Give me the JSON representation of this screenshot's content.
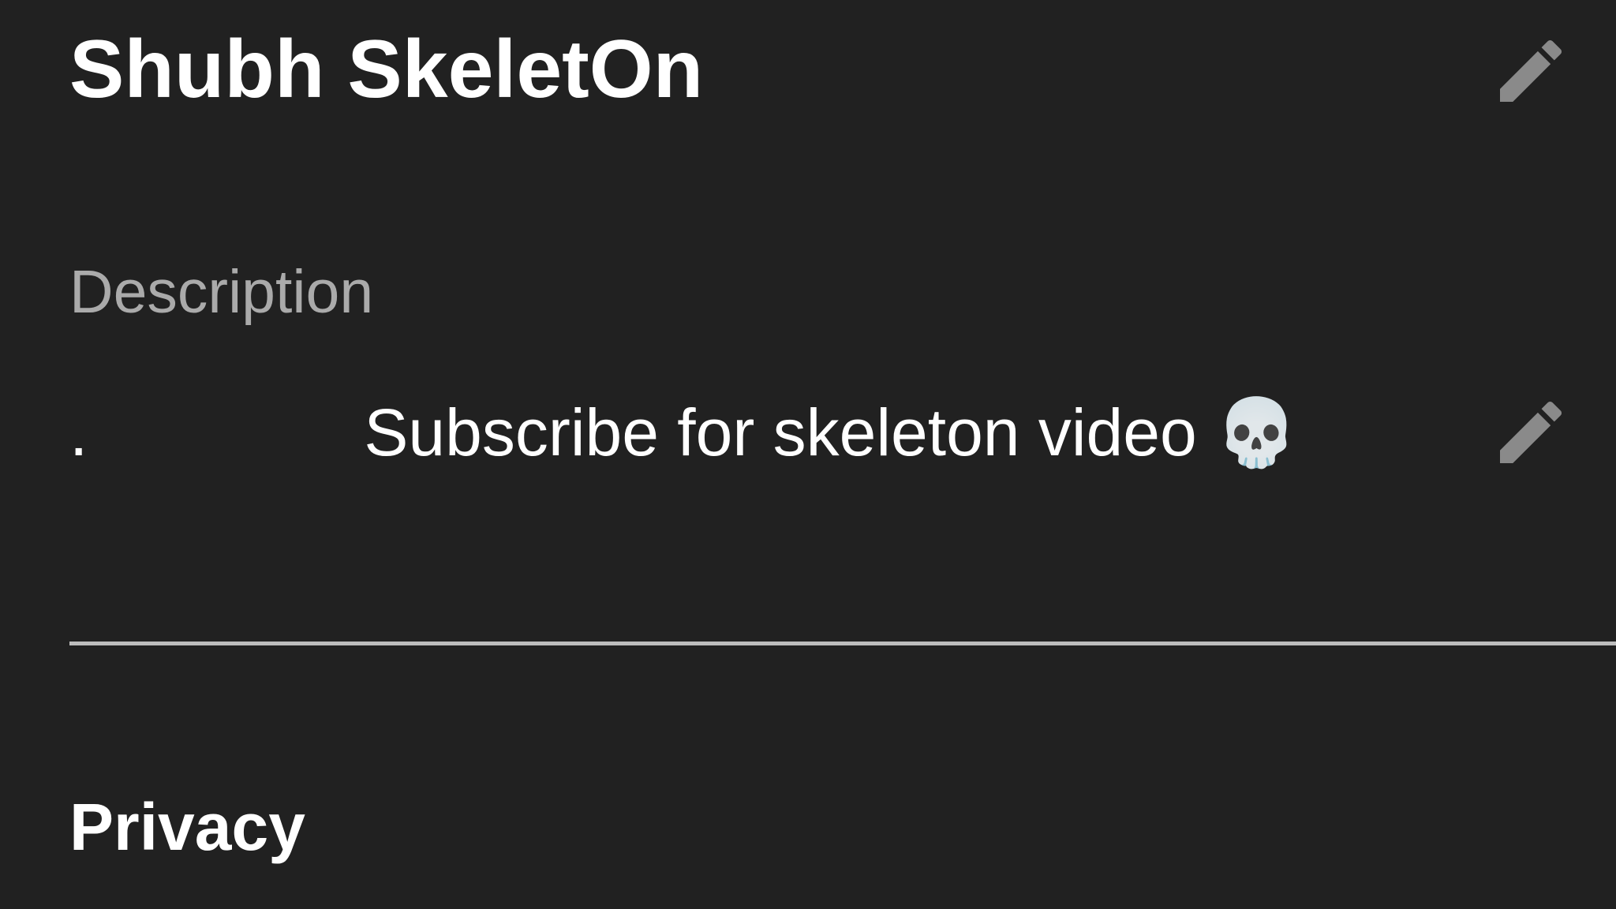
{
  "channel": {
    "name": "Shubh SkeletOn"
  },
  "description": {
    "label": "Description",
    "value": ".               Subscribe for skeleton video 💀"
  },
  "privacy": {
    "heading": "Privacy"
  },
  "icons": {
    "edit_name": "pencil-icon",
    "edit_description": "pencil-icon"
  },
  "colors": {
    "background": "#212121",
    "primary_text": "#ffffff",
    "secondary_text": "#aaaaaa",
    "icon": "#8a8a8a",
    "divider": "#bdbdbd"
  }
}
